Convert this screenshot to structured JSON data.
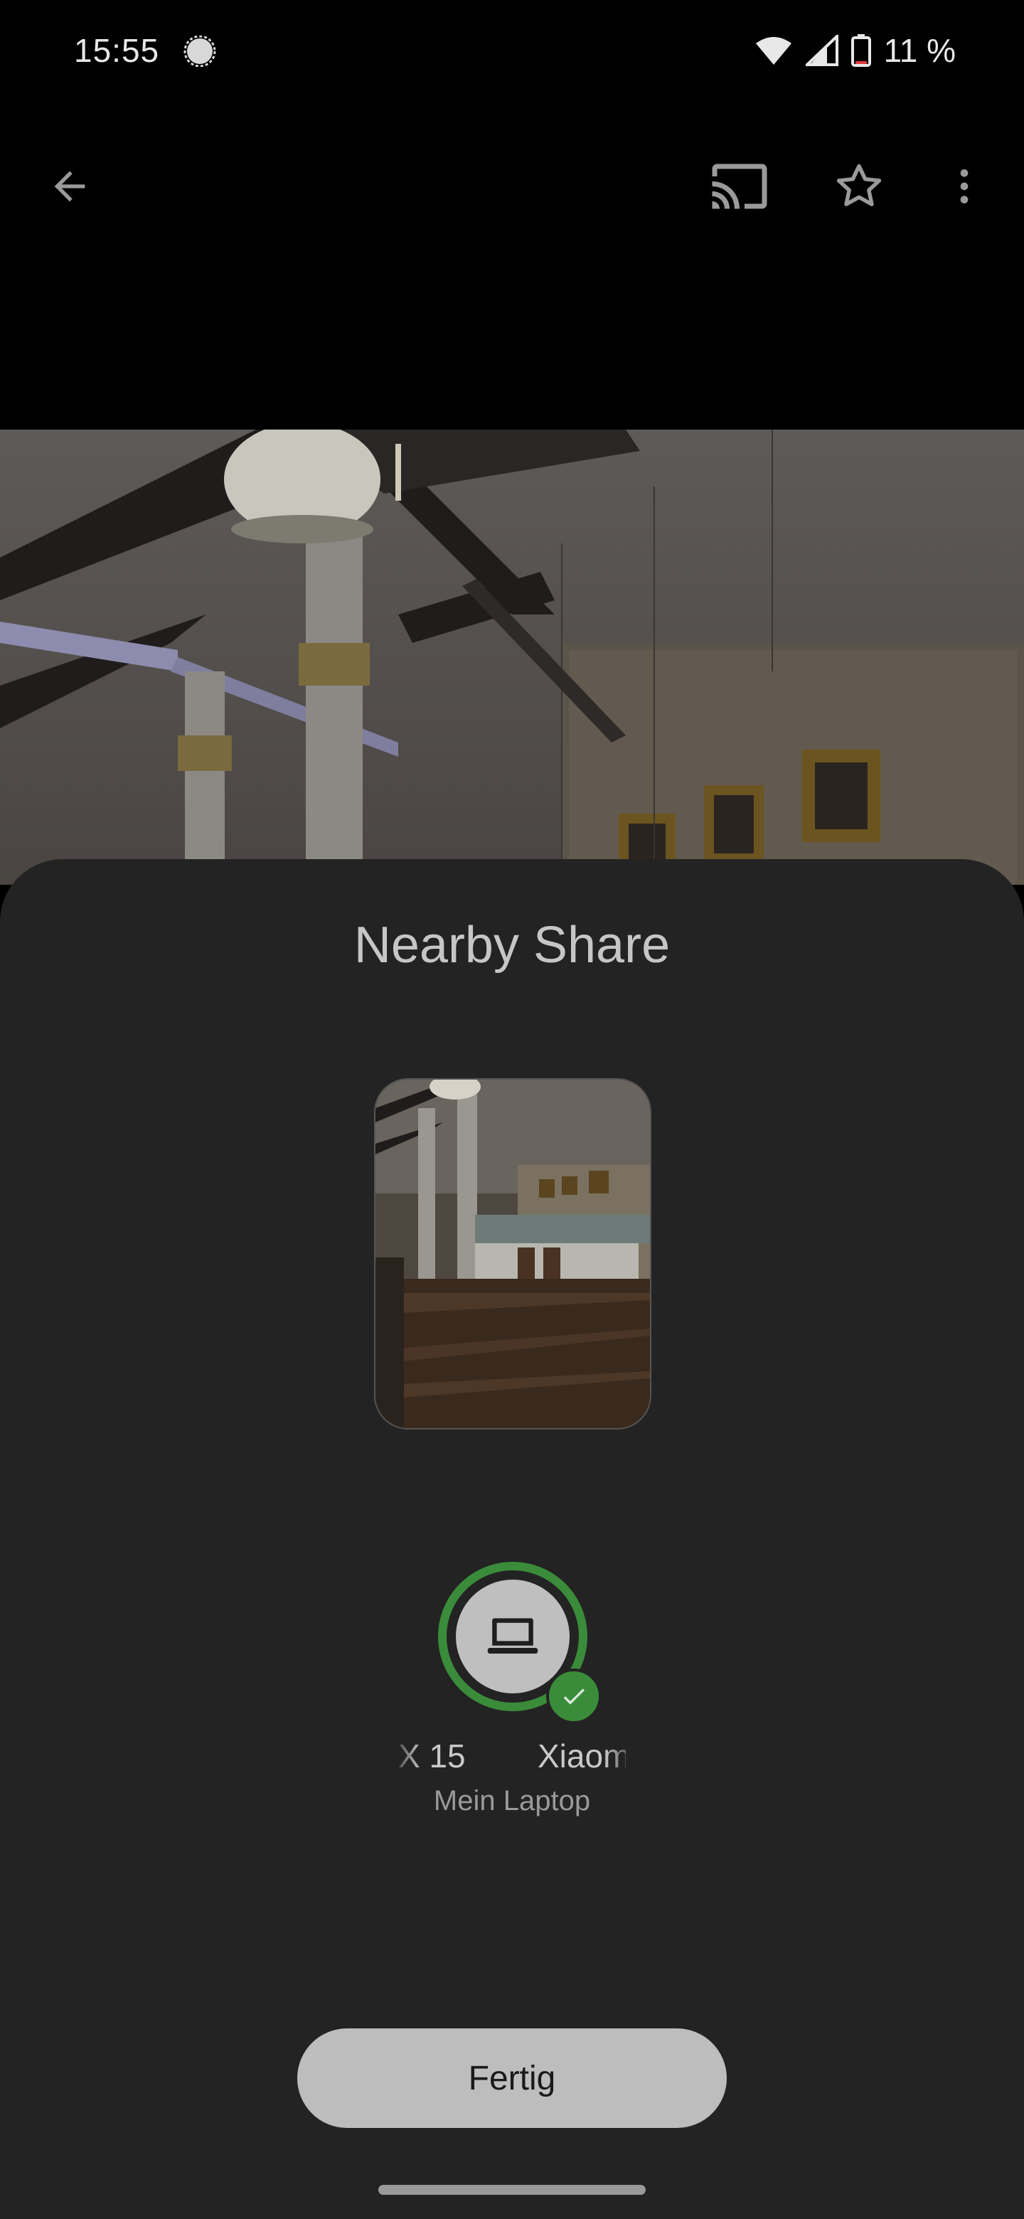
{
  "status_bar": {
    "time": "15:55",
    "battery": "11 %"
  },
  "app_bar": {
    "icons": [
      "back-arrow-icon",
      "cast-icon",
      "star-icon",
      "more-vert-icon"
    ]
  },
  "sheet": {
    "title": "Nearby Share",
    "device": {
      "left_label": "X 15",
      "right_label": "Xiaom",
      "subtitle": "Mein Laptop"
    },
    "done_label": "Fertig"
  },
  "colors": {
    "accent_green": "#3a8c3a",
    "sheet_bg": "#232323"
  }
}
